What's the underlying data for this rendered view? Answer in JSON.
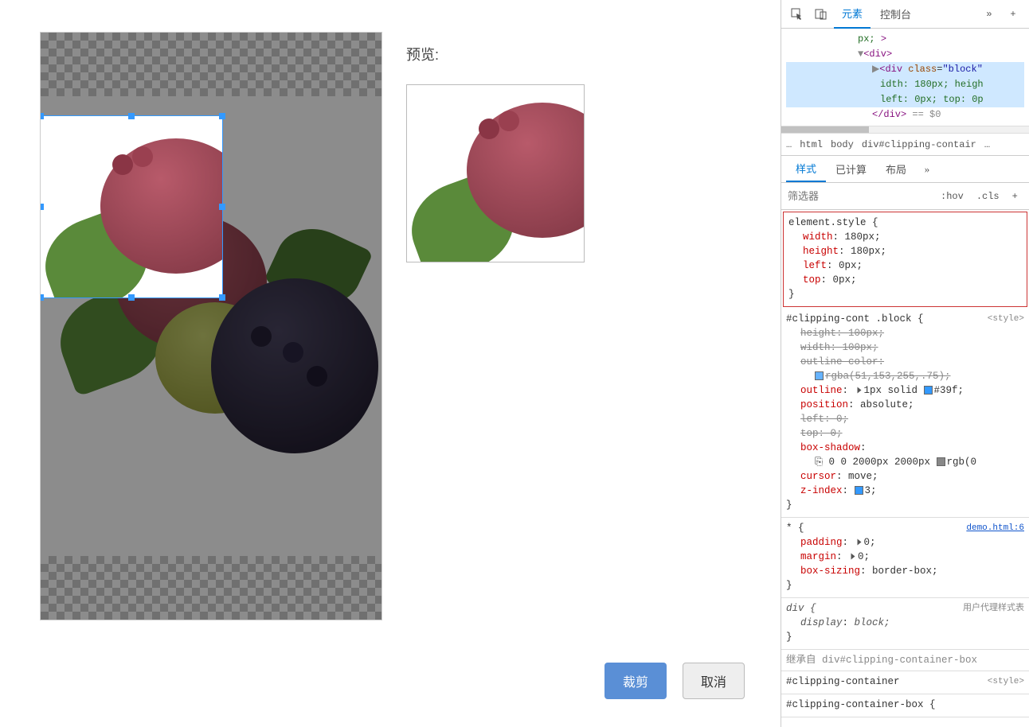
{
  "preview_label": "预览:",
  "buttons": {
    "crop": "裁剪",
    "cancel": "取消"
  },
  "devtools": {
    "tabs": {
      "elements": "元素",
      "console": "控制台"
    },
    "dom": {
      "line1_text": "px;",
      "line2_tag": "div",
      "line3": {
        "tag": "div",
        "attr": "class",
        "val": "block"
      },
      "line4": "idth: 180px; heigh",
      "line5": "left: 0px; top: 0p",
      "line6_close": "div",
      "line6_eq": "== $0"
    },
    "breadcrumb": {
      "b0": "…",
      "b1": "html",
      "b2": "body",
      "b3": "div#clipping-contair",
      "b4": "…"
    },
    "subtabs": {
      "styles": "样式",
      "computed": "已计算",
      "layout": "布局"
    },
    "filter_placeholder": "筛选器",
    "hov": ":hov",
    "cls": ".cls",
    "rule_element": {
      "selector": "element.style {",
      "p1n": "width",
      "p1v": "180px;",
      "p2n": "height",
      "p2v": "180px;",
      "p3n": "left",
      "p3v": "0px;",
      "p4n": "top",
      "p4v": "0px;",
      "close": "}"
    },
    "rule_block": {
      "selector": "#clipping-cont .block {",
      "src": "<style>",
      "p1n": "height",
      "p1v": "100px;",
      "p2n": "width",
      "p2v": "100px;",
      "p3n": "outline-color",
      "p3v": ":",
      "p3vv": "rgba(51,153,255,.75);",
      "p4n": "outline",
      "p4v": "1px solid ",
      "p4c": "#39f;",
      "p5n": "position",
      "p5v": "absolute;",
      "p6n": "left",
      "p6v": "0;",
      "p7n": "top",
      "p7v": "0;",
      "p8n": "box-shadow",
      "p8v": ":",
      "p8vv": "0 0 2000px 2000px ",
      "p8c": "rgb(0",
      "p9n": "cursor",
      "p9v": "move;",
      "p10n": "z-index",
      "p10v": "3;",
      "close": "}"
    },
    "rule_star": {
      "selector": "* {",
      "src": "demo.html:6",
      "p1n": "padding",
      "p1v": "0;",
      "p2n": "margin",
      "p2v": "0;",
      "p3n": "box-sizing",
      "p3v": "border-box;",
      "close": "}"
    },
    "rule_ua": {
      "selector": "div {",
      "src": "用户代理样式表",
      "p1n": "display",
      "p1v": "block;",
      "close": "}"
    },
    "inherit_label": "继承自",
    "inherit_from": "div#clipping-container-box",
    "rule_container": {
      "selector": "#clipping-container",
      "src": "<style>"
    },
    "rule_container_box": {
      "selector": "#clipping-container-box {"
    }
  }
}
